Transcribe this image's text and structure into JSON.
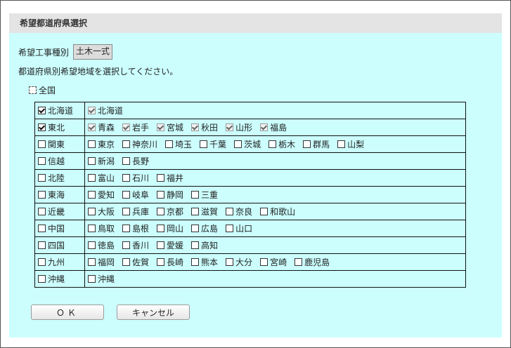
{
  "panel": {
    "title": "希望都道府県選択"
  },
  "work_type": {
    "label": "希望工事種別",
    "value": "土木一式"
  },
  "instruction": "都道府県別希望地域を選択してください。",
  "all_option": {
    "label": "全国",
    "checked": false
  },
  "regions": [
    {
      "key": "hokkaido",
      "label": "北海道",
      "checked": true,
      "prefectures": [
        {
          "label": "北海道",
          "checked": true
        }
      ]
    },
    {
      "key": "tohoku",
      "label": "東北",
      "checked": true,
      "prefectures": [
        {
          "label": "青森",
          "checked": true
        },
        {
          "label": "岩手",
          "checked": true
        },
        {
          "label": "宮城",
          "checked": true
        },
        {
          "label": "秋田",
          "checked": true
        },
        {
          "label": "山形",
          "checked": true
        },
        {
          "label": "福島",
          "checked": true
        }
      ]
    },
    {
      "key": "kanto",
      "label": "関東",
      "checked": false,
      "prefectures": [
        {
          "label": "東京",
          "checked": false
        },
        {
          "label": "神奈川",
          "checked": false
        },
        {
          "label": "埼玉",
          "checked": false
        },
        {
          "label": "千葉",
          "checked": false
        },
        {
          "label": "茨城",
          "checked": false
        },
        {
          "label": "栃木",
          "checked": false
        },
        {
          "label": "群馬",
          "checked": false
        },
        {
          "label": "山梨",
          "checked": false
        }
      ]
    },
    {
      "key": "shinetsu",
      "label": "信越",
      "checked": false,
      "prefectures": [
        {
          "label": "新潟",
          "checked": false
        },
        {
          "label": "長野",
          "checked": false
        }
      ]
    },
    {
      "key": "hokuriku",
      "label": "北陸",
      "checked": false,
      "prefectures": [
        {
          "label": "富山",
          "checked": false
        },
        {
          "label": "石川",
          "checked": false
        },
        {
          "label": "福井",
          "checked": false
        }
      ]
    },
    {
      "key": "tokai",
      "label": "東海",
      "checked": false,
      "prefectures": [
        {
          "label": "愛知",
          "checked": false
        },
        {
          "label": "岐阜",
          "checked": false
        },
        {
          "label": "静岡",
          "checked": false
        },
        {
          "label": "三重",
          "checked": false
        }
      ]
    },
    {
      "key": "kinki",
      "label": "近畿",
      "checked": false,
      "prefectures": [
        {
          "label": "大阪",
          "checked": false
        },
        {
          "label": "兵庫",
          "checked": false
        },
        {
          "label": "京都",
          "checked": false
        },
        {
          "label": "滋賀",
          "checked": false
        },
        {
          "label": "奈良",
          "checked": false
        },
        {
          "label": "和歌山",
          "checked": false
        }
      ]
    },
    {
      "key": "chugoku",
      "label": "中国",
      "checked": false,
      "prefectures": [
        {
          "label": "鳥取",
          "checked": false
        },
        {
          "label": "島根",
          "checked": false
        },
        {
          "label": "岡山",
          "checked": false
        },
        {
          "label": "広島",
          "checked": false
        },
        {
          "label": "山口",
          "checked": false
        }
      ]
    },
    {
      "key": "shikoku",
      "label": "四国",
      "checked": false,
      "prefectures": [
        {
          "label": "徳島",
          "checked": false
        },
        {
          "label": "香川",
          "checked": false
        },
        {
          "label": "愛媛",
          "checked": false
        },
        {
          "label": "高知",
          "checked": false
        }
      ]
    },
    {
      "key": "kyushu",
      "label": "九州",
      "checked": false,
      "prefectures": [
        {
          "label": "福岡",
          "checked": false
        },
        {
          "label": "佐賀",
          "checked": false
        },
        {
          "label": "長崎",
          "checked": false
        },
        {
          "label": "熊本",
          "checked": false
        },
        {
          "label": "大分",
          "checked": false
        },
        {
          "label": "宮崎",
          "checked": false
        },
        {
          "label": "鹿児島",
          "checked": false
        }
      ]
    },
    {
      "key": "okinawa",
      "label": "沖縄",
      "checked": false,
      "prefectures": [
        {
          "label": "沖縄",
          "checked": false
        }
      ]
    }
  ],
  "buttons": {
    "ok": "ＯＫ",
    "cancel": "キャンセル"
  }
}
